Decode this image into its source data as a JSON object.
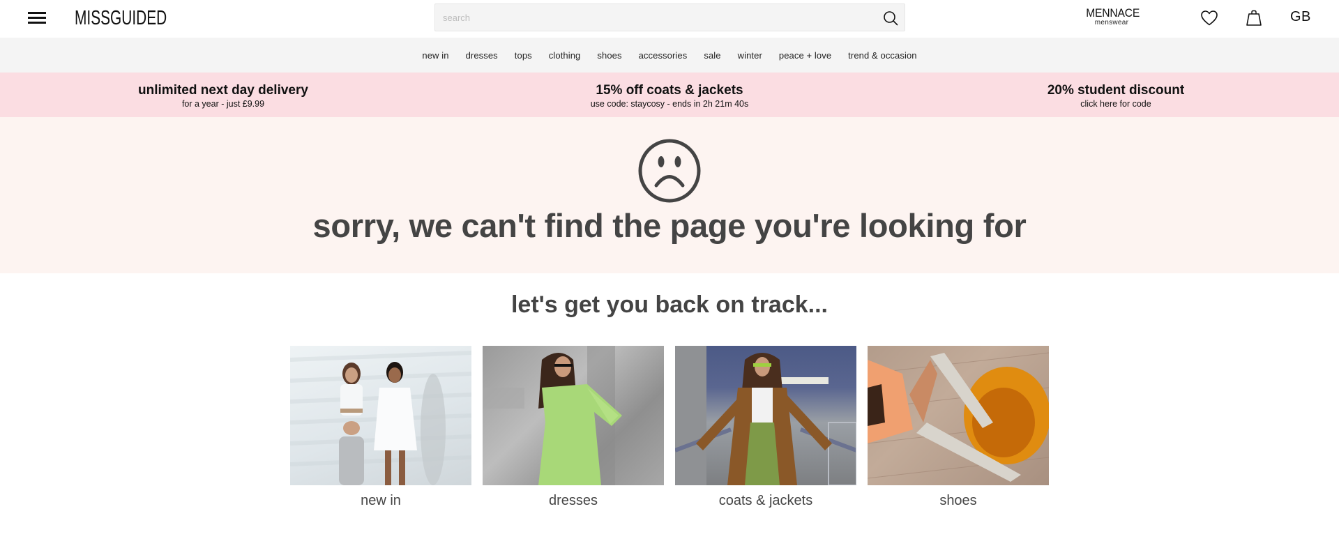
{
  "header": {
    "logo": "MISSGUIDED",
    "search_placeholder": "search",
    "search_value": "",
    "mennace_title": "MENNACE",
    "mennace_subtitle": "menswear",
    "country": "GB"
  },
  "nav": {
    "items": [
      {
        "label": "new in"
      },
      {
        "label": "dresses"
      },
      {
        "label": "tops"
      },
      {
        "label": "clothing"
      },
      {
        "label": "shoes"
      },
      {
        "label": "accessories"
      },
      {
        "label": "sale"
      },
      {
        "label": "winter"
      },
      {
        "label": "peace + love"
      },
      {
        "label": "trend & occasion"
      }
    ]
  },
  "promos": [
    {
      "title": "unlimited next day delivery",
      "subtitle": "for a year - just £9.99"
    },
    {
      "title": "15% off coats & jackets",
      "subtitle": "use code: staycosy - ends in 2h 21m 40s"
    },
    {
      "title": "20% student discount",
      "subtitle": "click here for code"
    }
  ],
  "error": {
    "icon": "sad-face-icon",
    "message": "sorry, we can't find the page you're looking for"
  },
  "recovery": {
    "title": "let's get you back on track...",
    "categories": [
      {
        "label": "new in",
        "image": "two models in white outfits"
      },
      {
        "label": "dresses",
        "image": "model in lime green shirt dress"
      },
      {
        "label": "coats & jackets",
        "image": "model in brown teddy coat"
      },
      {
        "label": "shoes",
        "image": "snakeskin over-the-knee boots"
      }
    ]
  },
  "colors": {
    "nav_bg": "#f4f4f4",
    "promo_bg": "#fbdde2",
    "hero_bg": "#fdf4f1",
    "heading_text": "#444444"
  }
}
